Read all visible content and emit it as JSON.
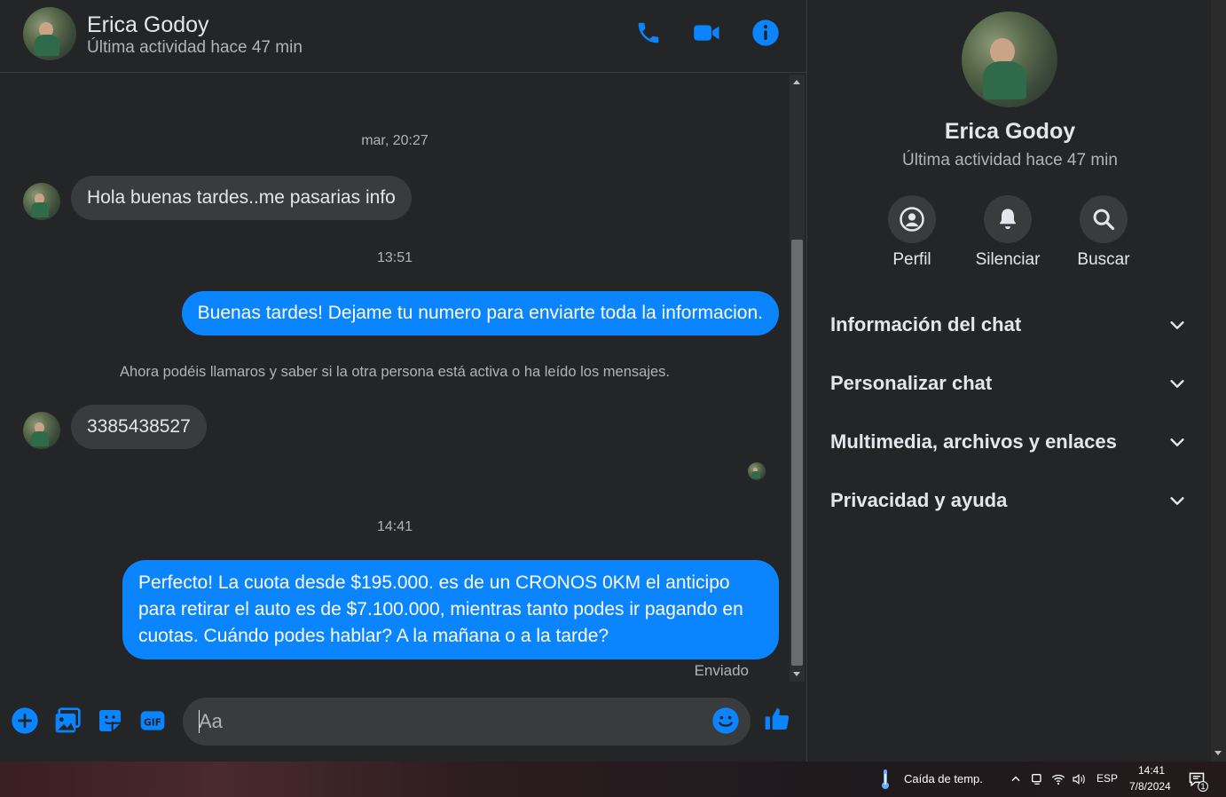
{
  "contact": {
    "name": "Erica Godoy",
    "status": "Última actividad hace 47 min"
  },
  "header_icons": [
    "phone-icon",
    "video-icon",
    "info-icon"
  ],
  "messages": {
    "ts1": "mar, 20:27",
    "in1": "Hola buenas tardes..me pasarias info",
    "ts2": "13:51",
    "out1": "Buenas tardes! Dejame tu numero para enviarte toda la informacion.",
    "note": "Ahora podéis llamaros y saber si la otra persona está activa o ha leído los mensajes.",
    "in2": "3385438527",
    "ts3": "14:41",
    "out2": "Perfecto! La cuota desde $195.000. es de un CRONOS 0KM el anticipo para retirar el auto es de $7.100.000, mientras tanto podes ir pagando en cuotas. Cuándo podes hablar? A la mañana o a la tarde?",
    "sent": "Enviado"
  },
  "composer": {
    "placeholder": "Aa",
    "icons": [
      "plus-icon",
      "image-icon",
      "sticker-icon",
      "gif-icon",
      "emoji-icon",
      "like-icon"
    ]
  },
  "info_panel": {
    "actions": [
      {
        "label": "Perfil",
        "icon": "profile-icon"
      },
      {
        "label": "Silenciar",
        "icon": "bell-icon"
      },
      {
        "label": "Buscar",
        "icon": "search-icon"
      }
    ],
    "sections": [
      "Información del chat",
      "Personalizar chat",
      "Multimedia, archivos y enlaces",
      "Privacidad y ayuda"
    ]
  },
  "taskbar": {
    "weather": "Caída de temp.",
    "language": "ESP",
    "time": "14:41",
    "date": "7/8/2024",
    "notifications": "1"
  },
  "colors": {
    "accent": "#0a84ff",
    "background": "#242526",
    "bubble_in": "#3a3b3c"
  }
}
